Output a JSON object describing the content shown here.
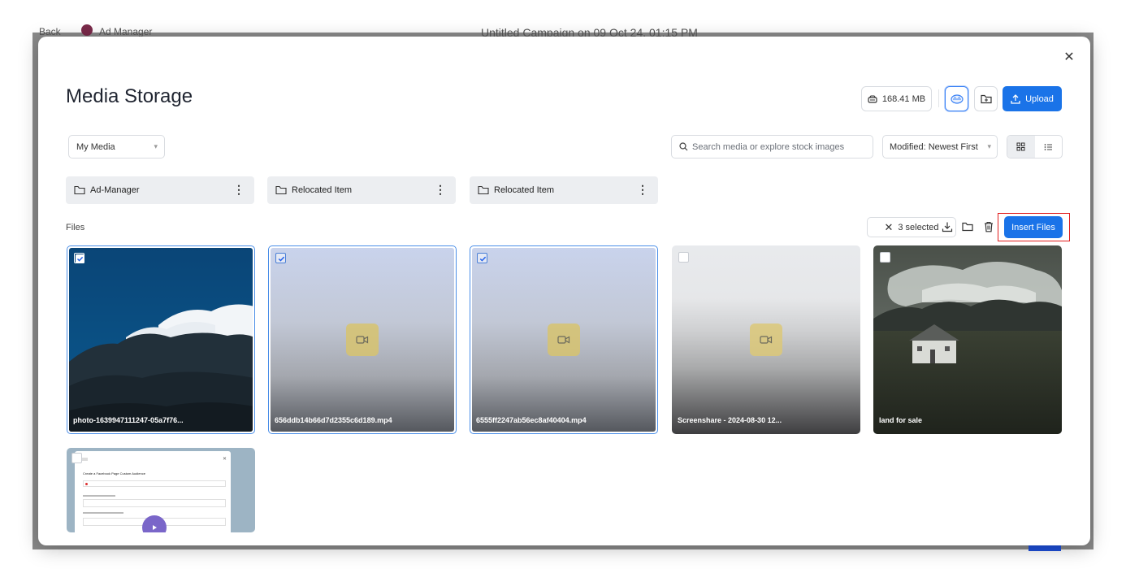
{
  "background": {
    "back_label": "Back",
    "app_name": "Ad Manager",
    "campaign_title": "Untitled Campaign on 09 Oct 24, 01:15 PM"
  },
  "modal": {
    "title": "Media Storage",
    "storage_used": "168.41 MB",
    "upload_label": "Upload",
    "source_select": "My Media",
    "search_placeholder": "Search media or explore stock images",
    "sort_select": "Modified: Newest First",
    "view_mode": "grid"
  },
  "folders": [
    {
      "label": "Ad-Manager"
    },
    {
      "label": "Relocated Item"
    },
    {
      "label": "Relocated Item"
    }
  ],
  "files_section": {
    "heading": "Files",
    "selected_count": "3 selected",
    "insert_label": "Insert Files"
  },
  "files": [
    {
      "name": "photo-1639947111247-05a7f76...",
      "type": "image",
      "selected": true
    },
    {
      "name": "656ddb14b66d7d2355c6d189.mp4",
      "type": "video",
      "selected": true
    },
    {
      "name": "6555ff2247ab56ec8af40404.mp4",
      "type": "video",
      "selected": true
    },
    {
      "name": "Screenshare - 2024-08-30 12...",
      "type": "video",
      "selected": false
    },
    {
      "name": "land for sale",
      "type": "image",
      "selected": false
    },
    {
      "name": "",
      "type": "video",
      "selected": false
    }
  ],
  "preview_thumb": {
    "heading": "Create a Facebook Page Custom Audience"
  },
  "colors": {
    "primary": "#1a73e8",
    "highlight": "#e11d1d",
    "selected_border": "#4a8ee8"
  }
}
